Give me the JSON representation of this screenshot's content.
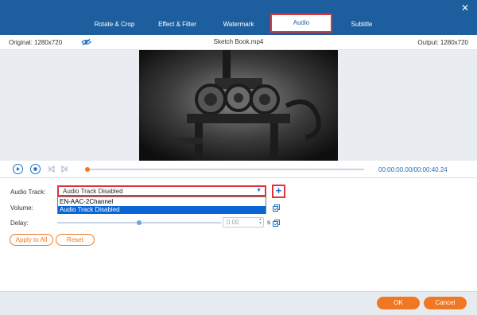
{
  "window": {
    "close_icon": "close-icon"
  },
  "tabs": [
    {
      "label": "Rotate & Crop"
    },
    {
      "label": "Effect & Filter"
    },
    {
      "label": "Watermark"
    },
    {
      "label": "Audio",
      "active": true
    },
    {
      "label": "Subtitle"
    }
  ],
  "info": {
    "original": "Original: 1280x720",
    "filename": "Sketch Book.mp4",
    "output": "Output: 1280x720",
    "preview_icon": "eye-icon"
  },
  "player": {
    "time": "00:00:00.00/00:00:40.24",
    "progress": 0.0
  },
  "audio": {
    "track_label": "Audio Track:",
    "track_value": "Audio Track Disabled",
    "track_options": [
      "EN-AAC-2Channel",
      "Audio Track Disabled"
    ],
    "volume_label": "Volume:",
    "delay_label": "Delay:",
    "delay_value": "0.00",
    "delay_unit": "s",
    "add_icon": "plus-icon"
  },
  "buttons": {
    "apply_all": "Apply to All",
    "reset": "Reset",
    "ok": "OK",
    "cancel": "Cancel"
  },
  "colors": {
    "header": "#1d5f9e",
    "accent": "#f07822",
    "highlight": "#e0343a",
    "selection": "#0a64d6"
  }
}
